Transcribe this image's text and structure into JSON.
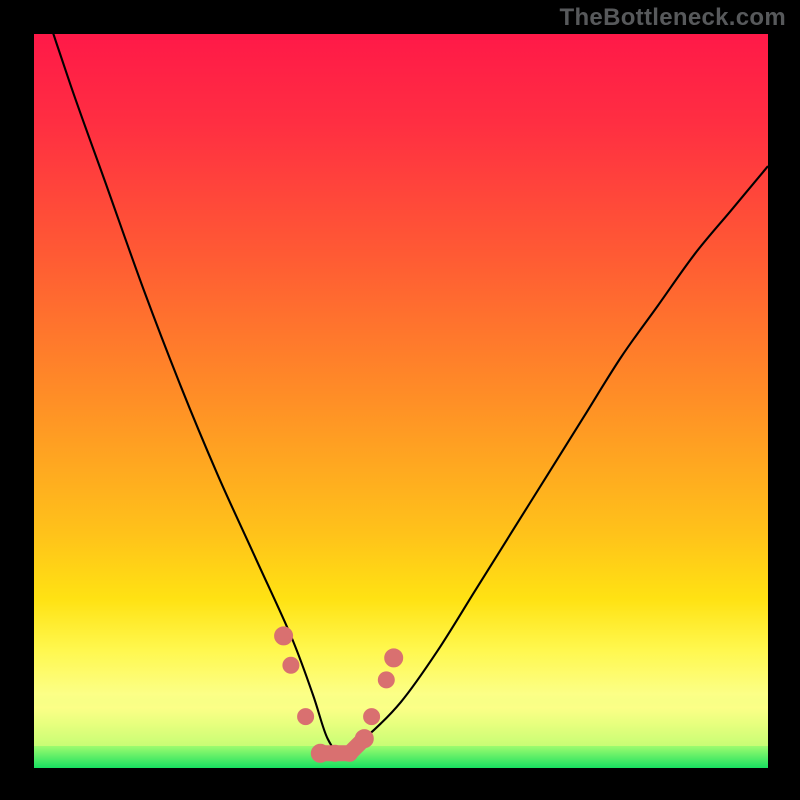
{
  "watermark": "TheBottleneck.com",
  "chart_data": {
    "type": "line",
    "title": "",
    "xlabel": "",
    "ylabel": "",
    "xlim": [
      0,
      100
    ],
    "ylim": [
      0,
      100
    ],
    "grid": false,
    "legend": false,
    "series": [
      {
        "name": "bottleneck-curve",
        "x": [
          0,
          5,
          10,
          15,
          20,
          25,
          30,
          35,
          38,
          40,
          42,
          45,
          50,
          55,
          60,
          65,
          70,
          75,
          80,
          85,
          90,
          95,
          100
        ],
        "y": [
          108,
          93,
          79,
          65,
          52,
          40,
          29,
          18,
          10,
          4,
          2,
          4,
          9,
          16,
          24,
          32,
          40,
          48,
          56,
          63,
          70,
          76,
          82
        ]
      }
    ],
    "markers": {
      "name": "highlight-points",
      "color": "#d97070",
      "x": [
        34,
        35,
        37,
        39,
        41,
        43,
        45,
        46,
        48,
        49
      ],
      "y": [
        18,
        14,
        7,
        2,
        2,
        2,
        4,
        7,
        12,
        15
      ]
    },
    "gradient_colors": {
      "c0": "#ff1948",
      "c1": "#ff2e42",
      "c2": "#ff5a34",
      "c3": "#ff8f26",
      "c4": "#ffc21a",
      "c5": "#ffe213",
      "c6": "#fff84f",
      "c7": "#fcff87",
      "c8": "#d6ff79",
      "c9": "#18e060"
    }
  }
}
